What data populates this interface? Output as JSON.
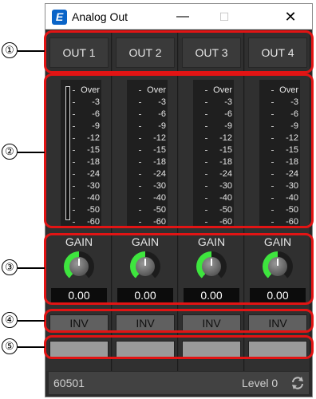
{
  "window": {
    "title": "Analog Out",
    "min_symbol": "—",
    "max_symbol": "☐",
    "close_symbol": "✕",
    "app_icon_letter": "E"
  },
  "scale": [
    "Over",
    "-3",
    "-6",
    "-9",
    "-12",
    "-15",
    "-18",
    "-24",
    "-30",
    "-40",
    "-50",
    "-60"
  ],
  "gain_label": "GAIN",
  "channels": [
    {
      "label": "OUT 1",
      "gain": "0.00",
      "inv": "INV"
    },
    {
      "label": "OUT 2",
      "gain": "0.00",
      "inv": "INV"
    },
    {
      "label": "OUT 3",
      "gain": "0.00",
      "inv": "INV"
    },
    {
      "label": "OUT 4",
      "gain": "0.00",
      "inv": "INV"
    }
  ],
  "status": {
    "id": "60501",
    "level": "Level 0",
    "sync_icon": "sync-icon"
  },
  "callouts": [
    "①",
    "②",
    "③",
    "④",
    "⑤"
  ],
  "colors": {
    "knob_active": "#3ee53e",
    "callout_border": "#e21414"
  }
}
